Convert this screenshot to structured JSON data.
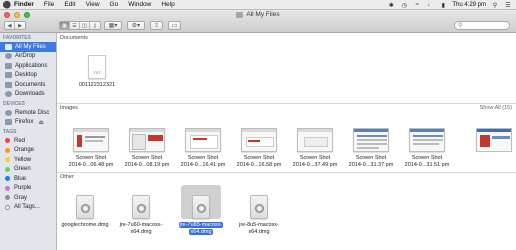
{
  "menubar": {
    "apple": "",
    "app": "Finder",
    "items": [
      "File",
      "Edit",
      "View",
      "Go",
      "Window",
      "Help"
    ],
    "clock": "Thu 4:29 pm"
  },
  "window": {
    "title": "All My Files"
  },
  "sidebar": {
    "favorites_heading": "FAVORITES",
    "favorites": [
      {
        "label": "All My Files",
        "icon": "all-files-icon",
        "selected": true
      },
      {
        "label": "AirDrop",
        "icon": "airdrop-icon"
      },
      {
        "label": "Applications",
        "icon": "applications-icon"
      },
      {
        "label": "Desktop",
        "icon": "desktop-icon"
      },
      {
        "label": "Documents",
        "icon": "documents-icon"
      },
      {
        "label": "Downloads",
        "icon": "downloads-icon"
      }
    ],
    "devices_heading": "DEVICES",
    "devices": [
      {
        "label": "Remote Disc",
        "icon": "remote-disc-icon"
      },
      {
        "label": "Firefox",
        "icon": "disk-image-icon"
      }
    ],
    "tags_heading": "TAGS",
    "tags": [
      {
        "label": "Red",
        "color": "#fc3d39"
      },
      {
        "label": "Orange",
        "color": "#fd9426"
      },
      {
        "label": "Yellow",
        "color": "#fecb2f"
      },
      {
        "label": "Green",
        "color": "#53d769"
      },
      {
        "label": "Blue",
        "color": "#147efb"
      },
      {
        "label": "Purple",
        "color": "#cc73e1"
      },
      {
        "label": "Gray",
        "color": "#8e8e93"
      },
      {
        "label": "All Tags...",
        "color": ""
      }
    ]
  },
  "content": {
    "documents_heading": "Documents",
    "documents": [
      {
        "name": "001122312321",
        "ext": "TXT"
      }
    ],
    "images_heading": "Images",
    "images_show_all": "Show All (15)",
    "images": [
      {
        "line1": "Screen Shot",
        "line2": "2014-0...06.48 pm"
      },
      {
        "line1": "Screen Shot",
        "line2": "2014-0...08.19 pm"
      },
      {
        "line1": "Screen Shot",
        "line2": "2014-0...16.41 pm"
      },
      {
        "line1": "Screen Shot",
        "line2": "2014-0...16.58 pm"
      },
      {
        "line1": "Screen Shot",
        "line2": "2014-0...37.49 pm"
      },
      {
        "line1": "Screen Shot",
        "line2": "2014-0...31.37 pm"
      },
      {
        "line1": "Screen Shot",
        "line2": "2014-0...31.51 pm"
      },
      {
        "line1": "",
        "line2": ""
      }
    ],
    "other_heading": "Other",
    "other": [
      {
        "line1": "googlechrome.dmg",
        "line2": "",
        "selected": false
      },
      {
        "line1": "jre-7u60-macosx-",
        "line2": "x64.dmg",
        "selected": false
      },
      {
        "line1": "jre-7u65-macosx-",
        "line2": "x64.dmg",
        "selected": true
      },
      {
        "line1": "jre-8u5-macosx-",
        "line2": "x64.dmg",
        "selected": false
      }
    ]
  }
}
